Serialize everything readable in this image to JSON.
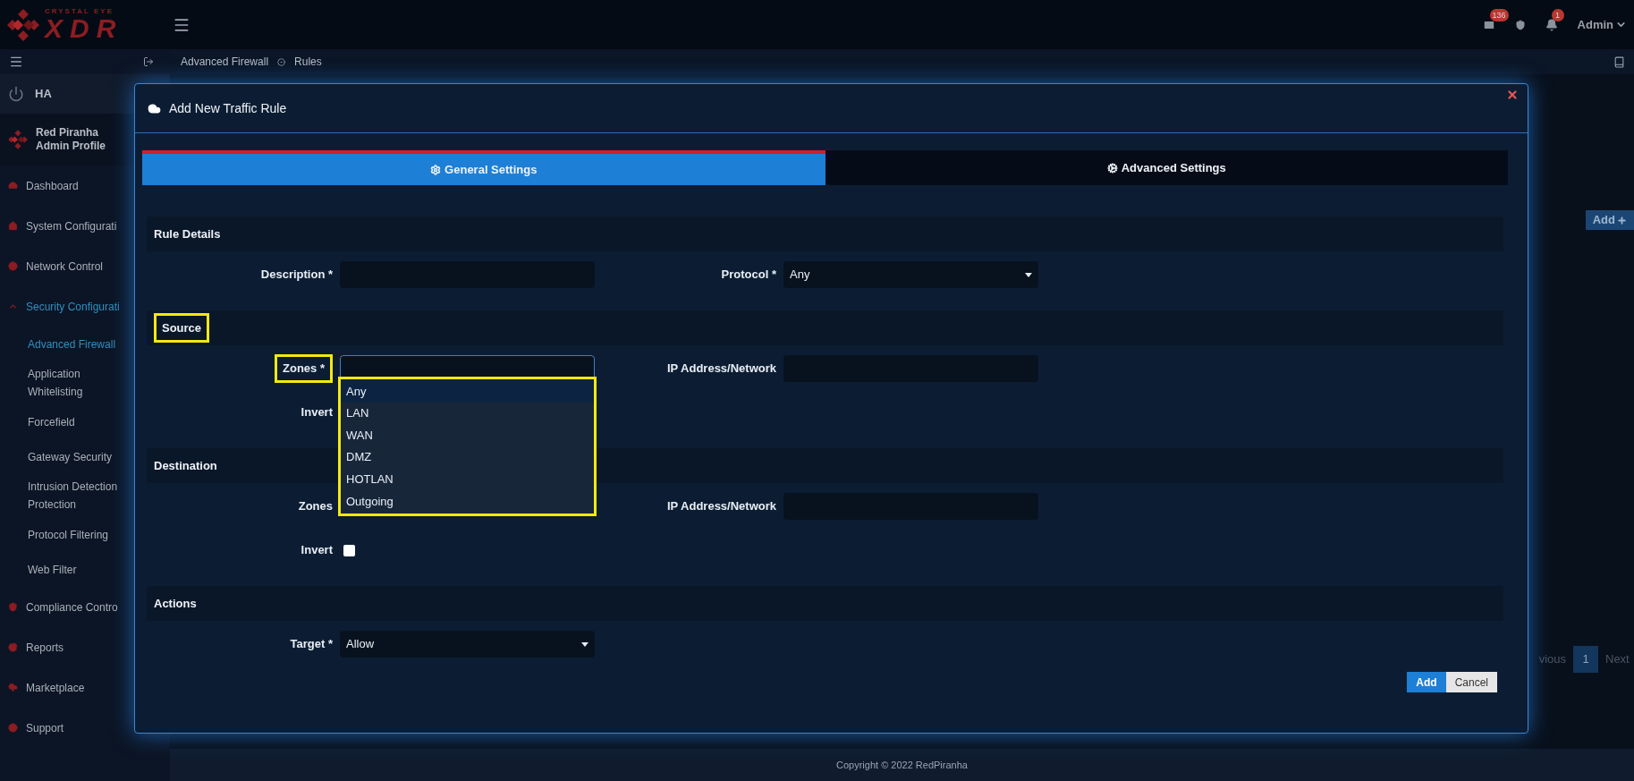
{
  "header": {
    "brand_small": "CRYSTAL EYE",
    "brand_large": "XDR",
    "mail_count": "136",
    "alert_count": "1",
    "user": "Admin"
  },
  "breadcrumb": [
    "Advanced Firewall",
    "Rules"
  ],
  "sidebar": {
    "ha_label": "HA",
    "profile": [
      "Red Piranha",
      "Admin Profile"
    ],
    "items": [
      {
        "label": "Dashboard",
        "selected": false,
        "expanded": false
      },
      {
        "label": "System Configurati",
        "selected": false,
        "expanded": false
      },
      {
        "label": "Network Control",
        "selected": false,
        "expanded": false
      },
      {
        "label": "Security Configurati",
        "selected": true,
        "expanded": true,
        "children": [
          {
            "label": "Advanced Firewall",
            "selected": true
          },
          {
            "label": "Application Whitelisting",
            "selected": false
          },
          {
            "label": "Forcefield",
            "selected": false
          },
          {
            "label": "Gateway Security",
            "selected": false
          },
          {
            "label": "Intrusion Detection Protection",
            "selected": false
          },
          {
            "label": "Protocol Filtering",
            "selected": false
          },
          {
            "label": "Web Filter",
            "selected": false
          }
        ]
      },
      {
        "label": "Compliance Contro",
        "selected": false,
        "expanded": false
      },
      {
        "label": "Reports",
        "selected": false,
        "expanded": false
      },
      {
        "label": "Marketplace",
        "selected": false,
        "expanded": false
      },
      {
        "label": "Support",
        "selected": false,
        "expanded": false
      }
    ]
  },
  "page": {
    "add_button": "Add",
    "pagination": {
      "previous": "vious",
      "pages": [
        {
          "label": "1",
          "selected": true
        }
      ],
      "next": "Next"
    },
    "footer": "Copyright © 2022 RedPiranha"
  },
  "modal": {
    "title": "Add New Traffic Rule",
    "tabs": [
      {
        "label": "General Settings",
        "selected": true
      },
      {
        "label": "Advanced Settings",
        "selected": false
      }
    ],
    "sections": [
      {
        "title": "Rule Details",
        "highlighted": false,
        "rows": [
          [
            {
              "kind": "text",
              "label": "Description *",
              "highlighted": false
            },
            {
              "kind": "select",
              "label": "Protocol *",
              "value": "Any",
              "highlighted": false
            }
          ]
        ]
      },
      {
        "title": "Source",
        "highlighted": true,
        "rows": [
          [
            {
              "kind": "dropdown",
              "label": "Zones *",
              "highlighted": true,
              "open": true
            },
            {
              "kind": "text",
              "label": "IP Address/Network",
              "highlighted": false
            }
          ],
          [
            {
              "kind": "label",
              "label": "Invert",
              "highlighted": false
            }
          ]
        ],
        "open_menu": {
          "highlighted": true,
          "options": [
            {
              "label": "Any",
              "selected": true
            },
            {
              "label": "LAN",
              "selected": false
            },
            {
              "label": "WAN",
              "selected": false
            },
            {
              "label": "DMZ",
              "selected": false
            },
            {
              "label": "HOTLAN",
              "selected": false
            },
            {
              "label": "Outgoing",
              "selected": false
            }
          ]
        }
      },
      {
        "title": "Destination",
        "highlighted": false,
        "rows": [
          [
            {
              "kind": "label",
              "label": "Zones",
              "highlighted": false
            },
            {
              "kind": "text",
              "label": "IP Address/Network",
              "highlighted": false
            }
          ],
          [
            {
              "kind": "checkbox",
              "label": "Invert",
              "checked": false,
              "highlighted": false
            }
          ]
        ]
      },
      {
        "title": "Actions",
        "highlighted": false,
        "rows": [
          [
            {
              "kind": "select",
              "label": "Target *",
              "value": "Allow",
              "highlighted": false
            }
          ]
        ]
      }
    ],
    "buttons": [
      {
        "label": "Add",
        "kind": "primary"
      },
      {
        "label": "Cancel",
        "kind": "secondary"
      }
    ]
  }
}
